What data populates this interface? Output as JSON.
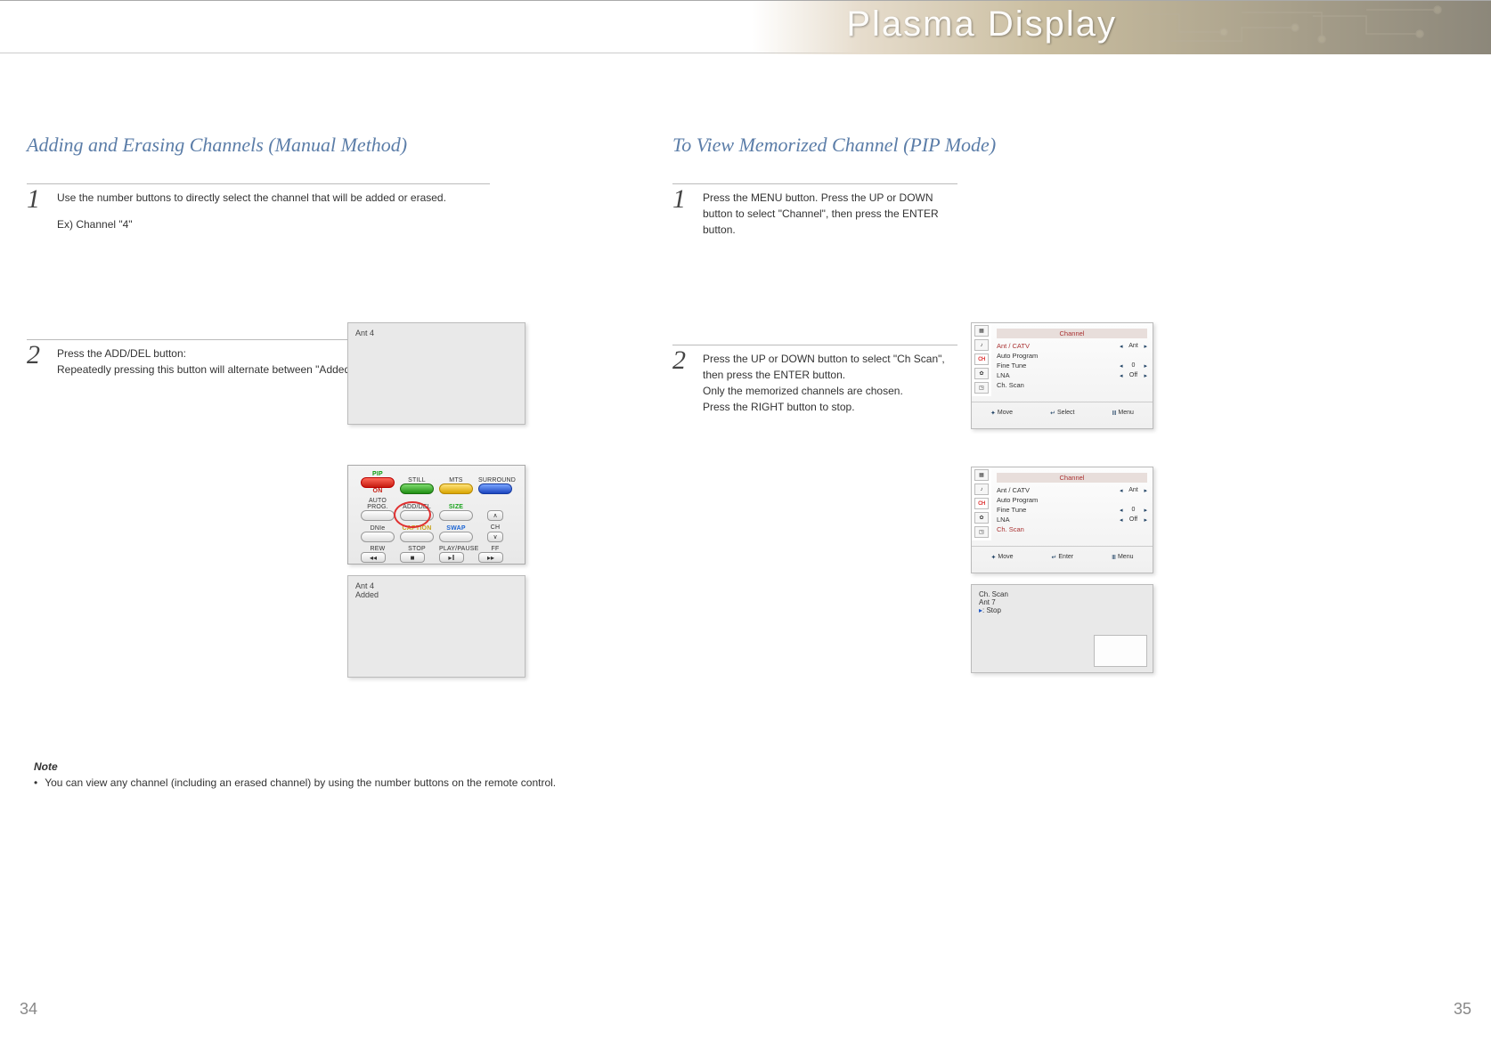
{
  "header": {
    "brand": "Plasma Display"
  },
  "pages": {
    "left": "34",
    "right": "35"
  },
  "left": {
    "title": "Adding and Erasing Channels (Manual Method)",
    "step1": {
      "num": "1",
      "text": "Use the number buttons to directly select the channel that will be added or erased.",
      "example": "Ex) Channel \"4\""
    },
    "step2": {
      "num": "2",
      "line1": "Press the ADD/DEL button:",
      "line2": "Repeatedly pressing this button will alternate between \"Added\" and \"Erased.\""
    },
    "osd1": "Ant 4",
    "osd3_l1": "Ant 4",
    "osd3_l2": "Added",
    "remote": {
      "r1": {
        "pip": "PIP",
        "on": "ON",
        "still": "STILL",
        "mts": "MTS",
        "surround": "SURROUND"
      },
      "r2": {
        "auto": "AUTO PROG.",
        "adddel": "ADD/DEL",
        "size": "SIZE"
      },
      "r3": {
        "dnie": "DNIe",
        "caption": "CAPTION",
        "swap": "SWAP",
        "ch": "CH"
      },
      "r4": {
        "rew": "REW",
        "stop": "STOP",
        "play": "PLAY/PAUSE",
        "ff": "FF"
      },
      "glyph": {
        "rew": "◂◂",
        "stop": "■",
        "play": "▸‖",
        "ff": "▸▸",
        "up": "∧",
        "down": "∨"
      }
    },
    "note": {
      "title": "Note",
      "text": "You can view any channel (including an erased channel) by using the number buttons on the remote control."
    }
  },
  "right": {
    "title": "To View Memorized Channel (PIP Mode)",
    "step1": {
      "num": "1",
      "text": "Press the MENU button. Press the UP or DOWN button to select \"Channel\", then press the ENTER button."
    },
    "step2": {
      "num": "2",
      "l1": "Press the UP or DOWN button to select \"Ch Scan\", then press the ENTER button.",
      "l2": "Only the memorized channels are chosen.",
      "l3": "Press the RIGHT button to stop."
    },
    "menu": {
      "title": "Channel",
      "rows": {
        "ant": {
          "label": "Ant / CATV",
          "value": "Ant"
        },
        "auto": {
          "label": "Auto Program"
        },
        "fine": {
          "label": "Fine Tune",
          "value": "0"
        },
        "lna": {
          "label": "LNA",
          "value": "Off"
        },
        "scan": {
          "label": "Ch. Scan"
        }
      },
      "footer1": {
        "move": "Move",
        "select": "Select",
        "menu": "Menu"
      },
      "footer2": {
        "move": "Move",
        "enter": "Enter",
        "menu": "Menu"
      },
      "icons": {
        "ch": "CH"
      }
    },
    "scan": {
      "l1": "Ch. Scan",
      "l2": "Ant  7",
      "stop": ": Stop"
    },
    "glyph": {
      "left": "◂",
      "right": "▸",
      "updown": "✦",
      "enter": "↵",
      "menu": "Ⅲ"
    }
  }
}
